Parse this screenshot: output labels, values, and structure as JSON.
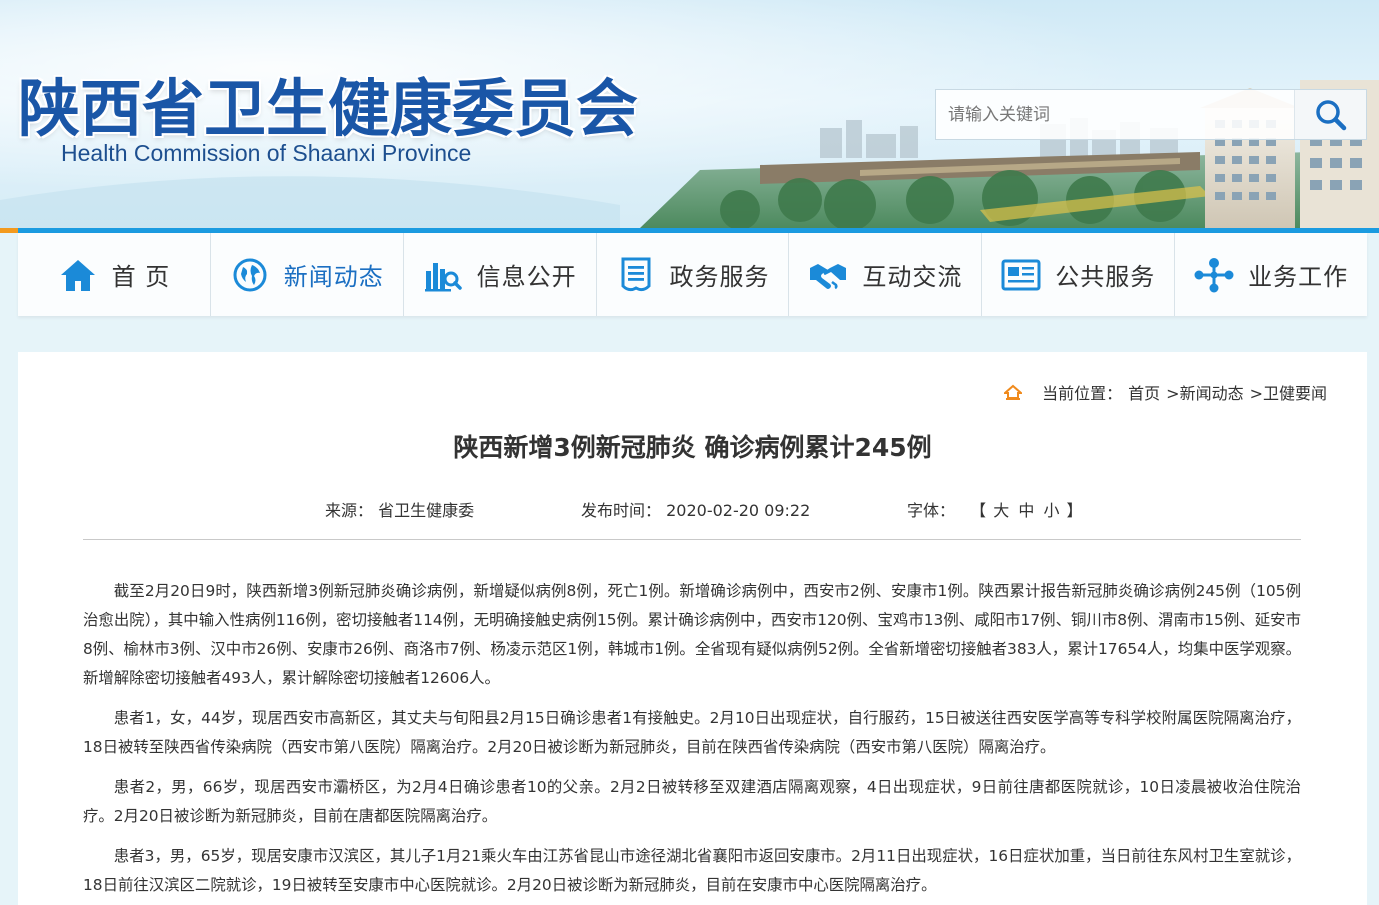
{
  "header": {
    "title": "陕西省卫生健康委员会",
    "subtitle": "Health Commission of Shaanxi Province",
    "search": {
      "placeholder": "请输入关键词"
    }
  },
  "nav": {
    "items": [
      {
        "label": "首 页",
        "icon": "home-icon"
      },
      {
        "label": "新闻动态",
        "icon": "globe-icon"
      },
      {
        "label": "信息公开",
        "icon": "chart-search-icon"
      },
      {
        "label": "政务服务",
        "icon": "document-list-icon"
      },
      {
        "label": "互动交流",
        "icon": "handshake-icon"
      },
      {
        "label": "公共服务",
        "icon": "newspaper-icon"
      },
      {
        "label": "业务工作",
        "icon": "network-nodes-icon"
      }
    ]
  },
  "breadcrumb": {
    "prefix": "当前位置：",
    "items": [
      "首页",
      ">新闻动态",
      ">卫健要闻"
    ]
  },
  "article": {
    "title": "陕西新增3例新冠肺炎 确诊病例累计245例",
    "source_label": "来源：",
    "source": "省卫生健康委",
    "time_label": "发布时间：",
    "time": "2020-02-20 09:22",
    "font_label": "字体：",
    "font_open": "【",
    "font_large": "大",
    "font_medium": "中",
    "font_small": "小",
    "font_close": "】",
    "paragraphs": [
      "截至2月20日9时，陕西新增3例新冠肺炎确诊病例，新增疑似病例8例，死亡1例。新增确诊病例中，西安市2例、安康市1例。陕西累计报告新冠肺炎确诊病例245例（105例治愈出院），其中输入性病例116例，密切接触者114例，无明确接触史病例15例。累计确诊病例中，西安市120例、宝鸡市13例、咸阳市17例、铜川市8例、渭南市15例、延安市8例、榆林市3例、汉中市26例、安康市26例、商洛市7例、杨凌示范区1例，韩城市1例。全省现有疑似病例52例。全省新增密切接触者383人，累计17654人，均集中医学观察。新增解除密切接触者493人，累计解除密切接触者12606人。",
      "患者1，女，44岁，现居西安市高新区，其丈夫与旬阳县2月15日确诊患者1有接触史。2月10日出现症状，自行服药，15日被送往西安医学高等专科学校附属医院隔离治疗，18日被转至陕西省传染病院（西安市第八医院）隔离治疗。2月20日被诊断为新冠肺炎，目前在陕西省传染病院（西安市第八医院）隔离治疗。",
      "患者2，男，66岁，现居西安市灞桥区，为2月4日确诊患者10的父亲。2月2日被转移至双建酒店隔离观察，4日出现症状，9日前往唐都医院就诊，10日凌晨被收治住院治疗。2月20日被诊断为新冠肺炎，目前在唐都医院隔离治疗。",
      "患者3，男，65岁，现居安康市汉滨区，其儿子1月21乘火车由江苏省昆山市途径湖北省襄阳市返回安康市。2月11日出现症状，16日症状加重，当日前往东风村卫生室就诊，18日前往汉滨区二院就诊，19日被转至安康市中心医院就诊。2月20日被诊断为新冠肺炎，目前在安康市中心医院隔离治疗。"
    ]
  },
  "colors": {
    "brand_blue": "#1a56a7",
    "nav_bar_blue": "#1b9be0",
    "accent_orange": "#f39a1e",
    "page_bg": "#e6f4f9"
  }
}
